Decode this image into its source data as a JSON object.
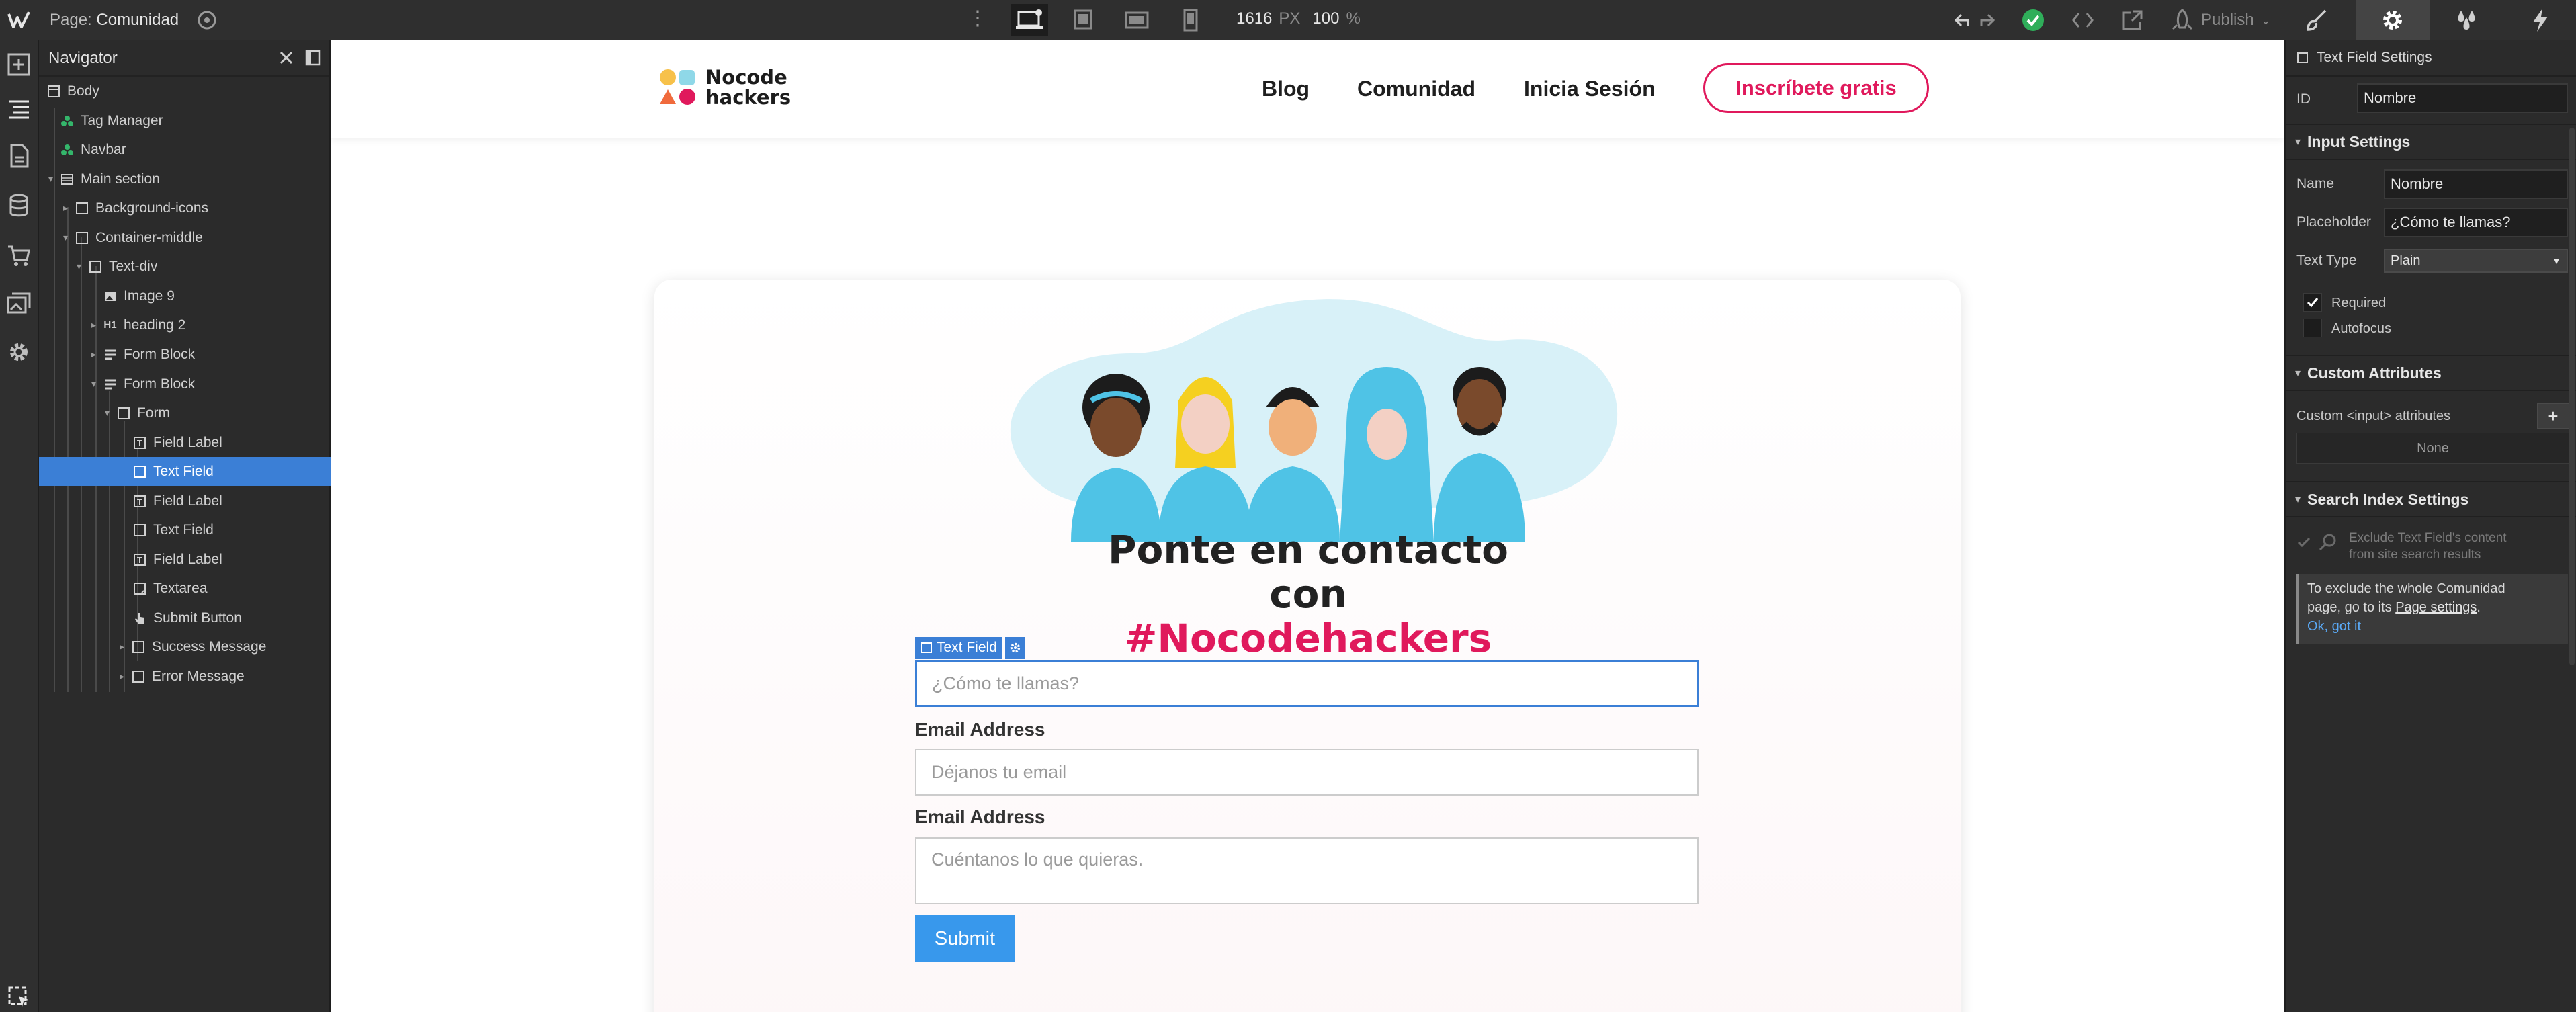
{
  "topbar": {
    "page_prefix": "Page:",
    "page_name": "Comunidad",
    "width_value": "1616",
    "width_unit": "PX",
    "zoom_value": "100",
    "zoom_unit": "%",
    "publish_label": "Publish"
  },
  "navigator": {
    "title": "Navigator",
    "items": [
      {
        "label": "Body"
      },
      {
        "label": "Tag Manager"
      },
      {
        "label": "Navbar"
      },
      {
        "label": "Main section"
      },
      {
        "label": "Background-icons"
      },
      {
        "label": "Container-middle"
      },
      {
        "label": "Text-div"
      },
      {
        "label": "Image 9"
      },
      {
        "label": "heading 2"
      },
      {
        "label": "Form Block"
      },
      {
        "label": "Form Block"
      },
      {
        "label": "Form"
      },
      {
        "label": "Field Label"
      },
      {
        "label": "Text Field"
      },
      {
        "label": "Field Label"
      },
      {
        "label": "Text Field"
      },
      {
        "label": "Field Label"
      },
      {
        "label": "Textarea"
      },
      {
        "label": "Submit Button"
      },
      {
        "label": "Success Message"
      },
      {
        "label": "Error Message"
      }
    ]
  },
  "site": {
    "brand_line1": "Nocode",
    "brand_line2": "hackers",
    "nav_links": [
      "Blog",
      "Comunidad",
      "Inicia Sesión"
    ],
    "cta_label": "Inscríbete gratis",
    "headline_line1": "Ponte en contacto con",
    "headline_line2": "#Nocodehackers",
    "selection_tag": "Text Field",
    "name_placeholder": "¿Cómo te llamas?",
    "email_label": "Email Address",
    "email_placeholder": "Déjanos tu email",
    "message_label": "Email Address",
    "message_placeholder": "Cuéntanos lo que quieras.",
    "submit_label": "Submit"
  },
  "panel": {
    "title": "Text Field Settings",
    "id_label": "ID",
    "id_value": "Nombre",
    "input_settings_title": "Input Settings",
    "name_label": "Name",
    "name_value": "Nombre",
    "placeholder_label": "Placeholder",
    "placeholder_value": "¿Cómo te llamas?",
    "text_type_label": "Text Type",
    "text_type_value": "Plain",
    "required_label": "Required",
    "autofocus_label": "Autofocus",
    "custom_attr_title": "Custom Attributes",
    "custom_attr_label": "Custom <input> attributes",
    "custom_attr_none": "None",
    "search_index_title": "Search Index Settings",
    "exclude_line1": "Exclude Text Field's content",
    "exclude_line2": "from site search results",
    "note_line1": "To exclude the whole Comunidad",
    "note_line2_pre": "page, go to its",
    "note_link": "Page settings",
    "note_dot": ".",
    "note_ok": "Ok, got it"
  },
  "colors": {
    "accent_blue": "#3b7fd6",
    "brand_pink": "#e0195c",
    "submit_blue": "#3898ec",
    "publish_check": "#2fae5a"
  }
}
